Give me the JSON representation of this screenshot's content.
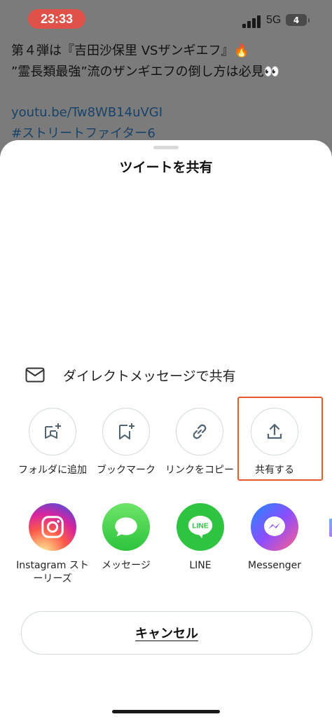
{
  "status_bar": {
    "time": "23:33",
    "network": "5G",
    "battery": "4"
  },
  "tweet": {
    "line1": "第４弾は『吉田沙保里 VSザンギエフ』🔥",
    "line2": "”霊長類最強”流のザンギエフの倒し方は必見👀",
    "link": "youtu.be/Tw8WB14uVGI",
    "hashtag": "#ストリートファイター6"
  },
  "sheet": {
    "title": "ツイートを共有",
    "dm_label": "ダイレクトメッセージで共有",
    "actions": [
      {
        "label": "フォルダに追加",
        "icon": "add-to-folder-icon"
      },
      {
        "label": "ブックマーク",
        "icon": "bookmark-add-icon"
      },
      {
        "label": "リンクをコピー",
        "icon": "link-icon"
      },
      {
        "label": "共有する",
        "icon": "share-upload-icon"
      }
    ],
    "apps": [
      {
        "label": "Instagram ストーリーズ",
        "icon": "instagram-icon",
        "color": "#d6249f"
      },
      {
        "label": "メッセージ",
        "icon": "messages-icon",
        "color": "#34c759"
      },
      {
        "label": "LINE",
        "icon": "line-icon",
        "color": "#2fc440"
      },
      {
        "label": "Messenger",
        "icon": "messenger-icon",
        "color": "#8a4dff"
      }
    ],
    "cancel_label": "キャンセル"
  },
  "colors": {
    "highlight": "#e85a2c",
    "dim_overlay": "#7b7b7b"
  }
}
